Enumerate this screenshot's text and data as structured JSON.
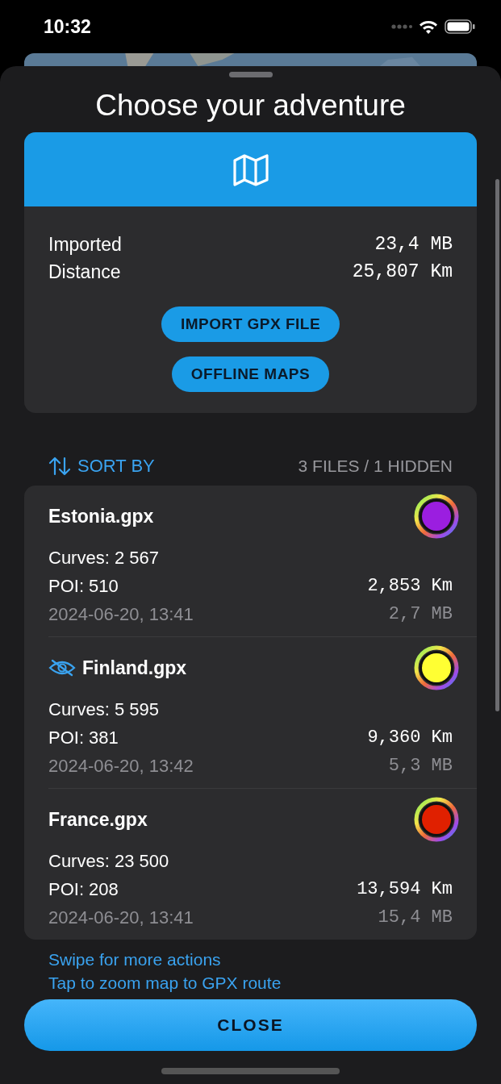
{
  "status_bar": {
    "time": "10:32"
  },
  "sheet": {
    "title": "Choose your adventure"
  },
  "summary": {
    "rows": [
      {
        "label": "Imported",
        "value": "23,4 MB"
      },
      {
        "label": "Distance",
        "value": "25,807 Km"
      }
    ],
    "buttons": [
      "IMPORT GPX FILE",
      "OFFLINE MAPS"
    ]
  },
  "list_header": {
    "sort": "SORT BY",
    "count": "3 FILES / 1 HIDDEN"
  },
  "files": [
    {
      "name": "Estonia.gpx",
      "hidden": false,
      "color": "#9b1ee0",
      "curves": "Curves: 2 567",
      "poi": "POI: 510",
      "distance": "2,853 Km",
      "date": "2024-06-20, 13:41",
      "size": "2,7 MB"
    },
    {
      "name": "Finland.gpx",
      "hidden": true,
      "color": "#ffff33",
      "curves": "Curves: 5 595",
      "poi": "POI: 381",
      "distance": "9,360 Km",
      "date": "2024-06-20, 13:42",
      "size": "5,3 MB"
    },
    {
      "name": "France.gpx",
      "hidden": false,
      "color": "#e02000",
      "curves": "Curves: 23 500",
      "poi": "POI: 208",
      "distance": "13,594 Km",
      "date": "2024-06-20, 13:41",
      "size": "15,4 MB"
    }
  ],
  "hints": [
    "Swipe for more actions",
    "Tap to zoom map to GPX route"
  ],
  "close_button": "CLOSE"
}
